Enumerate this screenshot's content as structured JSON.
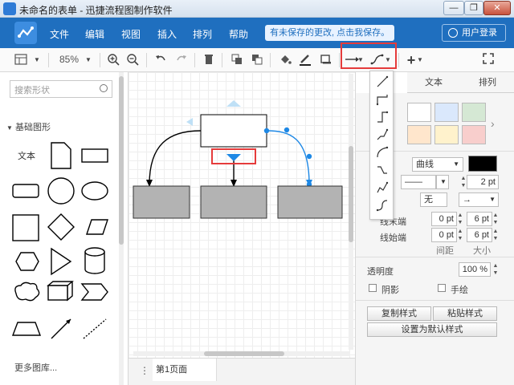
{
  "window": {
    "title": "未命名的表单 - 迅捷流程图制作软件",
    "minimize_glyph": "—",
    "restore_glyph": "❐",
    "close_glyph": "✕"
  },
  "menu": {
    "items": [
      "文件",
      "编辑",
      "视图",
      "插入",
      "排列",
      "帮助"
    ],
    "notice": "有未保存的更改, 点击我保存。",
    "login": "用户登录"
  },
  "toolbar": {
    "zoom": "85%",
    "icons": [
      "page-layout-icon",
      "zoom-in-icon",
      "zoom-out-icon",
      "undo-icon",
      "redo-icon",
      "delete-icon",
      "to-front-icon",
      "to-back-icon",
      "fill-color-icon",
      "line-color-icon",
      "shadow-icon",
      "connector-icon",
      "waypoint-icon",
      "insert-icon",
      "fullscreen-icon"
    ]
  },
  "left_panel": {
    "search_placeholder": "搜索形状",
    "section": "基础图形",
    "text_shape": "文本",
    "more_libraries": "更多图库..."
  },
  "right_panel": {
    "tabs": [
      "文本",
      "排列"
    ],
    "fill_colors": [
      "#ffffff",
      "#dae8fc",
      "#d5e8d4",
      "#ffe6cc",
      "#fff2cc",
      "#f8cecc",
      "#e1d5e7"
    ],
    "style_value": "曲线",
    "line_color": "#000000",
    "line_width": "2 pt",
    "arrow_none": "无",
    "arrow_right": "→",
    "end_label": "线末端",
    "start_label": "线始端",
    "end_spacing": "0 pt",
    "end_size": "6 pt",
    "start_spacing": "0 pt",
    "start_size": "6 pt",
    "spacing_label": "间距",
    "size_label": "大小",
    "opacity_label": "透明度",
    "opacity_value": "100 %",
    "shadow_label": "阴影",
    "sketch_label": "手绘",
    "copy_style": "复制样式",
    "paste_style": "粘贴样式",
    "set_default": "设置为默认样式"
  },
  "page_tab": "第1页面",
  "colors": {
    "menu_bar": "#1f6fbf",
    "selection_blue": "#1e88e5",
    "highlight_red": "#e53b3b",
    "box_gray": "#b3b3b3"
  }
}
